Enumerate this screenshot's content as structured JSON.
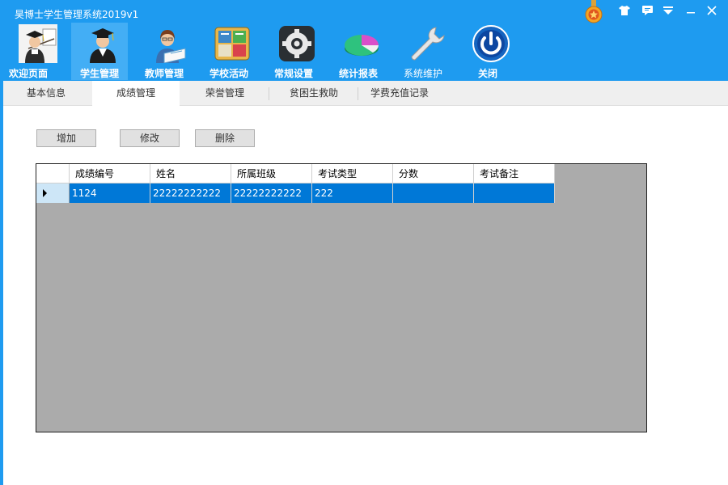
{
  "app": {
    "title": "昊博士学生管理系统2019v1"
  },
  "nav": {
    "items": [
      {
        "label": "欢迎页面"
      },
      {
        "label": "学生管理"
      },
      {
        "label": "教师管理"
      },
      {
        "label": "学校活动"
      },
      {
        "label": "常规设置"
      },
      {
        "label": "统计报表"
      },
      {
        "label": "系统维护"
      },
      {
        "label": "关闭"
      }
    ],
    "active": "学生管理"
  },
  "tabs": {
    "items": [
      {
        "label": "基本信息"
      },
      {
        "label": "成绩管理"
      },
      {
        "label": "荣誉管理"
      },
      {
        "label": "贫困生救助"
      },
      {
        "label": "学费充值记录"
      }
    ],
    "active": "成绩管理"
  },
  "toolbar": {
    "add": "增加",
    "edit": "修改",
    "delete": "删除"
  },
  "grid": {
    "columns": [
      "成绩编号",
      "姓名",
      "所属班级",
      "考试类型",
      "分数",
      "考试备注"
    ],
    "rows": [
      [
        "1124",
        "22222222222",
        "22222222222",
        "222",
        "",
        ""
      ]
    ]
  },
  "colors": {
    "header_bg": "#1e9bf0",
    "active_nav_bg": "#43aef5",
    "selection": "#0078d7",
    "grid_bg": "#ababab"
  },
  "icons": {
    "title_bar": [
      "medal-icon",
      "shirt-icon",
      "chat-icon",
      "menu-icon",
      "minimize-icon",
      "close-icon"
    ],
    "nav": [
      "teacher-doctor-icon",
      "graduate-icon",
      "female-teacher-icon",
      "activity-board-icon",
      "gear-icon",
      "pie-chart-icon",
      "wrench-icon",
      "power-icon"
    ]
  }
}
